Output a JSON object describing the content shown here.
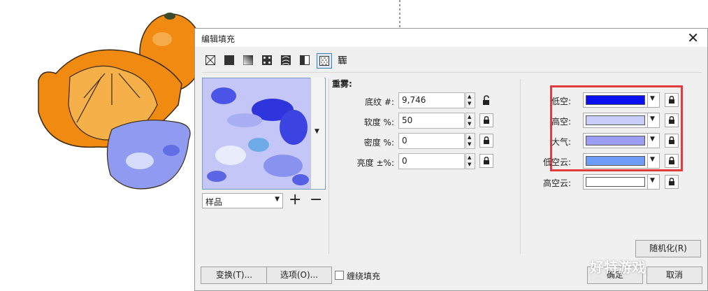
{
  "dialog": {
    "title": "编辑填充",
    "fill_types": [
      "no-fill",
      "uniform-fill",
      "fountain-fill",
      "vector-pattern-fill",
      "bitmap-pattern-fill",
      "two-color-pattern-fill",
      "texture-fill",
      "postscript-fill"
    ],
    "active_fill_type": "texture-fill",
    "library_select": "样品",
    "section_title": "重雾:",
    "fields": [
      {
        "label": "底纹 #:",
        "value": "9,746"
      },
      {
        "label": "软度 %:",
        "value": "50"
      },
      {
        "label": "密度 %:",
        "value": "0"
      },
      {
        "label": "亮度 ±%:",
        "value": "0"
      }
    ],
    "colors": [
      {
        "label": "低空:",
        "color": "#0a10f0"
      },
      {
        "label": "高空:",
        "color": "#c9cdfb"
      },
      {
        "label": "大气:",
        "color": "#9c9ef6"
      },
      {
        "label": "低空云:",
        "color": "#6f9cf7"
      },
      {
        "label": "高空云:",
        "color": "#ffffff"
      }
    ],
    "randomize_label": "随机化(R)",
    "transform_label": "变换(T)...",
    "options_label": "选项(O)...",
    "wrap_fill_label": "缠绕填充",
    "ok_label": "确定",
    "cancel_label": "取消"
  },
  "accent": "#e23b3b",
  "watermark": "好特游戏"
}
